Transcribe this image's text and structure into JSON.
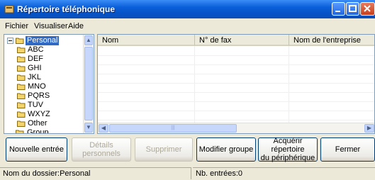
{
  "window": {
    "title": "Répertoire téléphonique"
  },
  "menu": [
    "Fichier",
    "Visualiser",
    "Aide"
  ],
  "tree": {
    "root": "Personal",
    "children": [
      "ABC",
      "DEF",
      "GHI",
      "JKL",
      "MNO",
      "PQRS",
      "TUV",
      "WXYZ",
      "Other"
    ],
    "next_root": "Group"
  },
  "list": {
    "columns": [
      "Nom",
      "N° de fax",
      "Nom de l'entreprise"
    ]
  },
  "buttons": {
    "new_entry": "Nouvelle entrée",
    "personal_details": "Détails personnels",
    "delete": "Supprimer",
    "modify_group": "Modifier groupe",
    "acquire_line1": "Acquérir répertoire",
    "acquire_line2": "du périphérique",
    "close": "Fermer"
  },
  "status": {
    "folder": "Nom du dossier:Personal",
    "entries": "Nb. entrées:0"
  },
  "colors": {
    "titlebar": "#0a5fd8",
    "selection": "#316ac5",
    "folder": "#f3d56b"
  }
}
